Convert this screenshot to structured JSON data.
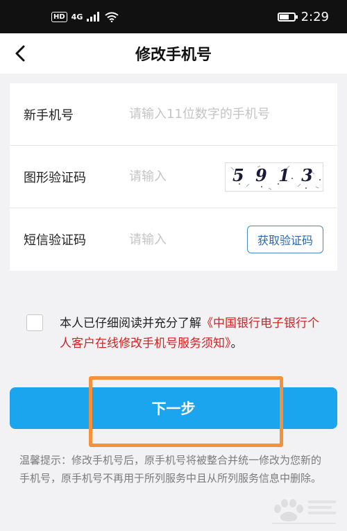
{
  "status_bar": {
    "hd": "HD",
    "network": "4G",
    "time": "2:29"
  },
  "header": {
    "title": "修改手机号",
    "back_icon": "chevron-left-icon"
  },
  "form": {
    "phone": {
      "label": "新手机号",
      "placeholder": "请输入11位数字的手机号"
    },
    "captcha": {
      "label": "图形验证码",
      "placeholder": "请输入",
      "image_text": "5 9 1 3"
    },
    "sms": {
      "label": "短信验证码",
      "placeholder": "请输入",
      "button": "获取验证码"
    }
  },
  "agreement": {
    "checked": false,
    "text": "本人已仔细阅读并充分了解",
    "link": "《中国银行电子银行个人客户在线修改手机号服务须知》",
    "suffix": "。"
  },
  "next_button": "下一步",
  "tips": "温馨提示：修改手机号后，原手机号将被整合并统一修改为您新的手机号，原手机号不再用于所列服务中且从所列服务信息中删除。",
  "colors": {
    "primary": "#1aa5ee",
    "highlight": "#f5913a",
    "link_red": "#d42020",
    "button_border": "#4a86c8"
  }
}
